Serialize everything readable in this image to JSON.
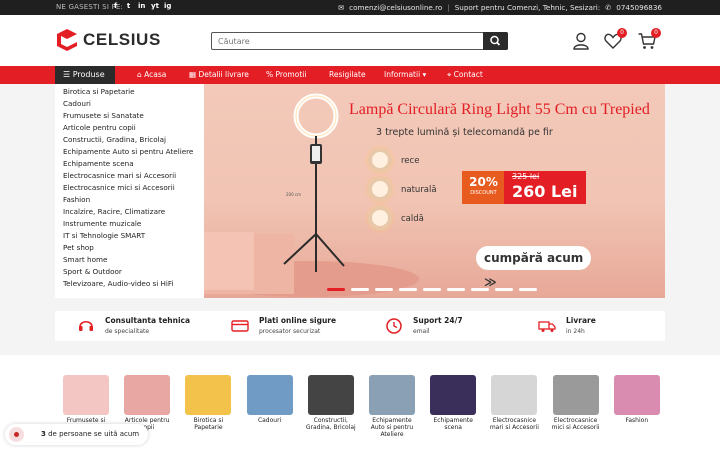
{
  "topbar": {
    "follow_label": "NE GASESTI SI PE:",
    "socials": [
      "f",
      "t",
      "in",
      "yt",
      "ig"
    ],
    "email": "comenzi@celsiusonline.ro",
    "support": "Suport pentru Comenzi, Tehnic, Sesizari:",
    "phone": "0745096836"
  },
  "header": {
    "logo_text": "CELSIUS",
    "search_placeholder": "Căutare",
    "wishlist_count": "0",
    "cart_count": "0"
  },
  "nav": {
    "products_label": "Produse",
    "items": [
      {
        "label": "Acasa",
        "icon": "home-icon"
      },
      {
        "label": "Detalii livrare",
        "icon": "calendar-icon"
      },
      {
        "label": "Promotii",
        "icon": "percent-icon"
      },
      {
        "label": "Resigilate",
        "icon": ""
      },
      {
        "label": "Informatii",
        "icon": "chevron-down-icon"
      },
      {
        "label": "Contact",
        "icon": "map-pin-icon"
      }
    ]
  },
  "categories_menu": [
    "Birotica si Papetarie",
    "Cadouri",
    "Frumusete si Sanatate",
    "Articole pentru copii",
    "Constructii, Gradina, Bricolaj",
    "Echipamente Auto si pentru Ateliere",
    "Echipamente scena",
    "Electrocasnice mari si Accesorii",
    "Electrocasnice mici si Accesorii",
    "Fashion",
    "Incalzire, Racire, Climatizare",
    "Instrumente muzicale",
    "IT si Tehnologie SMART",
    "Pet shop",
    "Smart home",
    "Sport & Outdoor",
    "Televizoare, Audio-video si HiFi"
  ],
  "banner": {
    "title": "Lampă Circulară Ring Light 55 Cm cu Trepied",
    "subtitle": "3 trepte lumină și telecomandă pe fir",
    "levels": [
      "rece",
      "naturală",
      "caldă"
    ],
    "discount_pct": "20%",
    "discount_label": "DISCOUNT",
    "old_price": "325 lei",
    "new_price": "260 Lei",
    "cta": "cumpără acum ≫",
    "slide_count": 9,
    "active_slide": 0
  },
  "features": [
    {
      "title": "Consultanta tehnica",
      "sub": "de specialitate",
      "icon": "headset-icon"
    },
    {
      "title": "Plati online sigure",
      "sub": "procesator securizat",
      "icon": "card-icon"
    },
    {
      "title": "Suport 24/7",
      "sub": "email",
      "icon": "clock-icon"
    },
    {
      "title": "Livrare",
      "sub": "in 24h",
      "icon": "truck-icon"
    }
  ],
  "category_tiles": [
    {
      "label": "Frumusete si Sanatate",
      "color": "#f3c6c4"
    },
    {
      "label": "Articole pentru copii",
      "color": "#e9a7a3"
    },
    {
      "label": "Birotica si Papetarie",
      "color": "#f2c24b"
    },
    {
      "label": "Cadouri",
      "color": "#6f9bc4"
    },
    {
      "label": "Constructii, Gradina, Bricolaj",
      "color": "#444444"
    },
    {
      "label": "Echipamente Auto si pentru Ateliere",
      "color": "#8aa1b5"
    },
    {
      "label": "Echipamente scena",
      "color": "#3a2e5a"
    },
    {
      "label": "Electrocasnice mari si Accesorii",
      "color": "#d6d6d6"
    },
    {
      "label": "Electrocasnice mici si Accesorii",
      "color": "#9a9a9a"
    },
    {
      "label": "Fashion",
      "color": "#d98bb0"
    }
  ],
  "watchers": {
    "count": "3",
    "text": "de persoane se uită acum"
  },
  "colors": {
    "brand_red": "#e31e24",
    "dark": "#2b2b2b",
    "topbar": "#1f1f1f"
  }
}
